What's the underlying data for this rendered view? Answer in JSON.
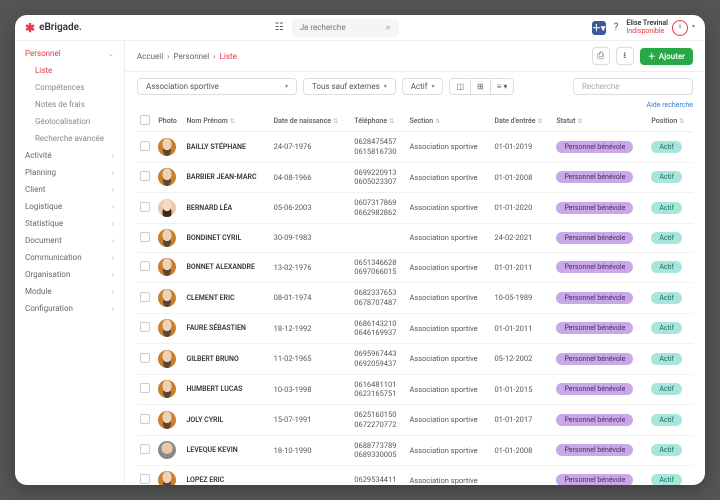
{
  "brand": "eBrigade.",
  "search": {
    "placeholder": "Je recherche"
  },
  "user": {
    "name": "Elise Trevinal",
    "status": "Indisponible"
  },
  "sidebar": {
    "main": "Personnel",
    "subs": [
      "Liste",
      "Compétences",
      "Notes de frais",
      "Géolocalisation",
      "Recherche avancée"
    ],
    "items": [
      "Activité",
      "Planning",
      "Client",
      "Logistique",
      "Statistique",
      "Document",
      "Communication",
      "Organisation",
      "Module",
      "Configuration"
    ]
  },
  "crumbs": {
    "a": "Accueil",
    "b": "Personnel",
    "c": "Liste"
  },
  "actions": {
    "add": "Ajouter"
  },
  "filters": {
    "org": "Association sportive",
    "scope": "Tous sauf externes",
    "status": "Actif",
    "search": "Recherche",
    "aide": "Aide recherche"
  },
  "cols": {
    "photo": "Photo",
    "name": "Nom Prénom",
    "dob": "Date de naissance",
    "tel": "Téléphone",
    "section": "Section",
    "entry": "Date d'entrée",
    "statut": "Statut",
    "pos": "Position"
  },
  "statut_label": "Personnel bénévole",
  "actif_label": "Actif",
  "section_label": "Association sportive",
  "rows": [
    {
      "name": "BAILLY STéPHANE",
      "dob": "24-07-1976",
      "t1": "0628475457",
      "t2": "0615816730",
      "entry": "01-01-2019",
      "av": "m"
    },
    {
      "name": "BARBIER JEAN-MARC",
      "dob": "04-08-1966",
      "t1": "0699220913",
      "t2": "0605023307",
      "entry": "01-01-2008",
      "av": "m"
    },
    {
      "name": "BERNARD LéA",
      "dob": "05-06-2003",
      "t1": "0607317869",
      "t2": "0662982862",
      "entry": "01-01-2020",
      "av": "f"
    },
    {
      "name": "BONDINET CYRIL",
      "dob": "30-09-1983",
      "t1": "",
      "t2": "",
      "entry": "24-02-2021",
      "av": "m"
    },
    {
      "name": "BONNET ALEXANDRE",
      "dob": "13-02-1976",
      "t1": "0651346628",
      "t2": "0697066015",
      "entry": "01-01-2011",
      "av": "m"
    },
    {
      "name": "CLEMENT ERIC",
      "dob": "08-01-1974",
      "t1": "0682337653",
      "t2": "0678707487",
      "entry": "10-05-1989",
      "av": "m"
    },
    {
      "name": "FAURE SéBASTIEN",
      "dob": "18-12-1992",
      "t1": "0686143210",
      "t2": "0646169937",
      "entry": "01-01-2011",
      "av": "m"
    },
    {
      "name": "GILBERT BRUNO",
      "dob": "11-02-1965",
      "t1": "0695967443",
      "t2": "0692059437",
      "entry": "05-12-2002",
      "av": "m"
    },
    {
      "name": "HUMBERT LUCAS",
      "dob": "10-03-1998",
      "t1": "0616481101",
      "t2": "0623165751",
      "entry": "01-01-2015",
      "av": "m"
    },
    {
      "name": "JOLY CYRIL",
      "dob": "15-07-1991",
      "t1": "0625160150",
      "t2": "0672270772",
      "entry": "01-01-2017",
      "av": "m"
    },
    {
      "name": "LEVEQUE KEVIN",
      "dob": "18-10-1990",
      "t1": "0688773789",
      "t2": "0689330005",
      "entry": "01-01-2008",
      "av": "p"
    },
    {
      "name": "LOPEZ ERIC",
      "dob": "",
      "t1": "0629534411",
      "t2": "",
      "entry": "",
      "av": "m"
    }
  ]
}
